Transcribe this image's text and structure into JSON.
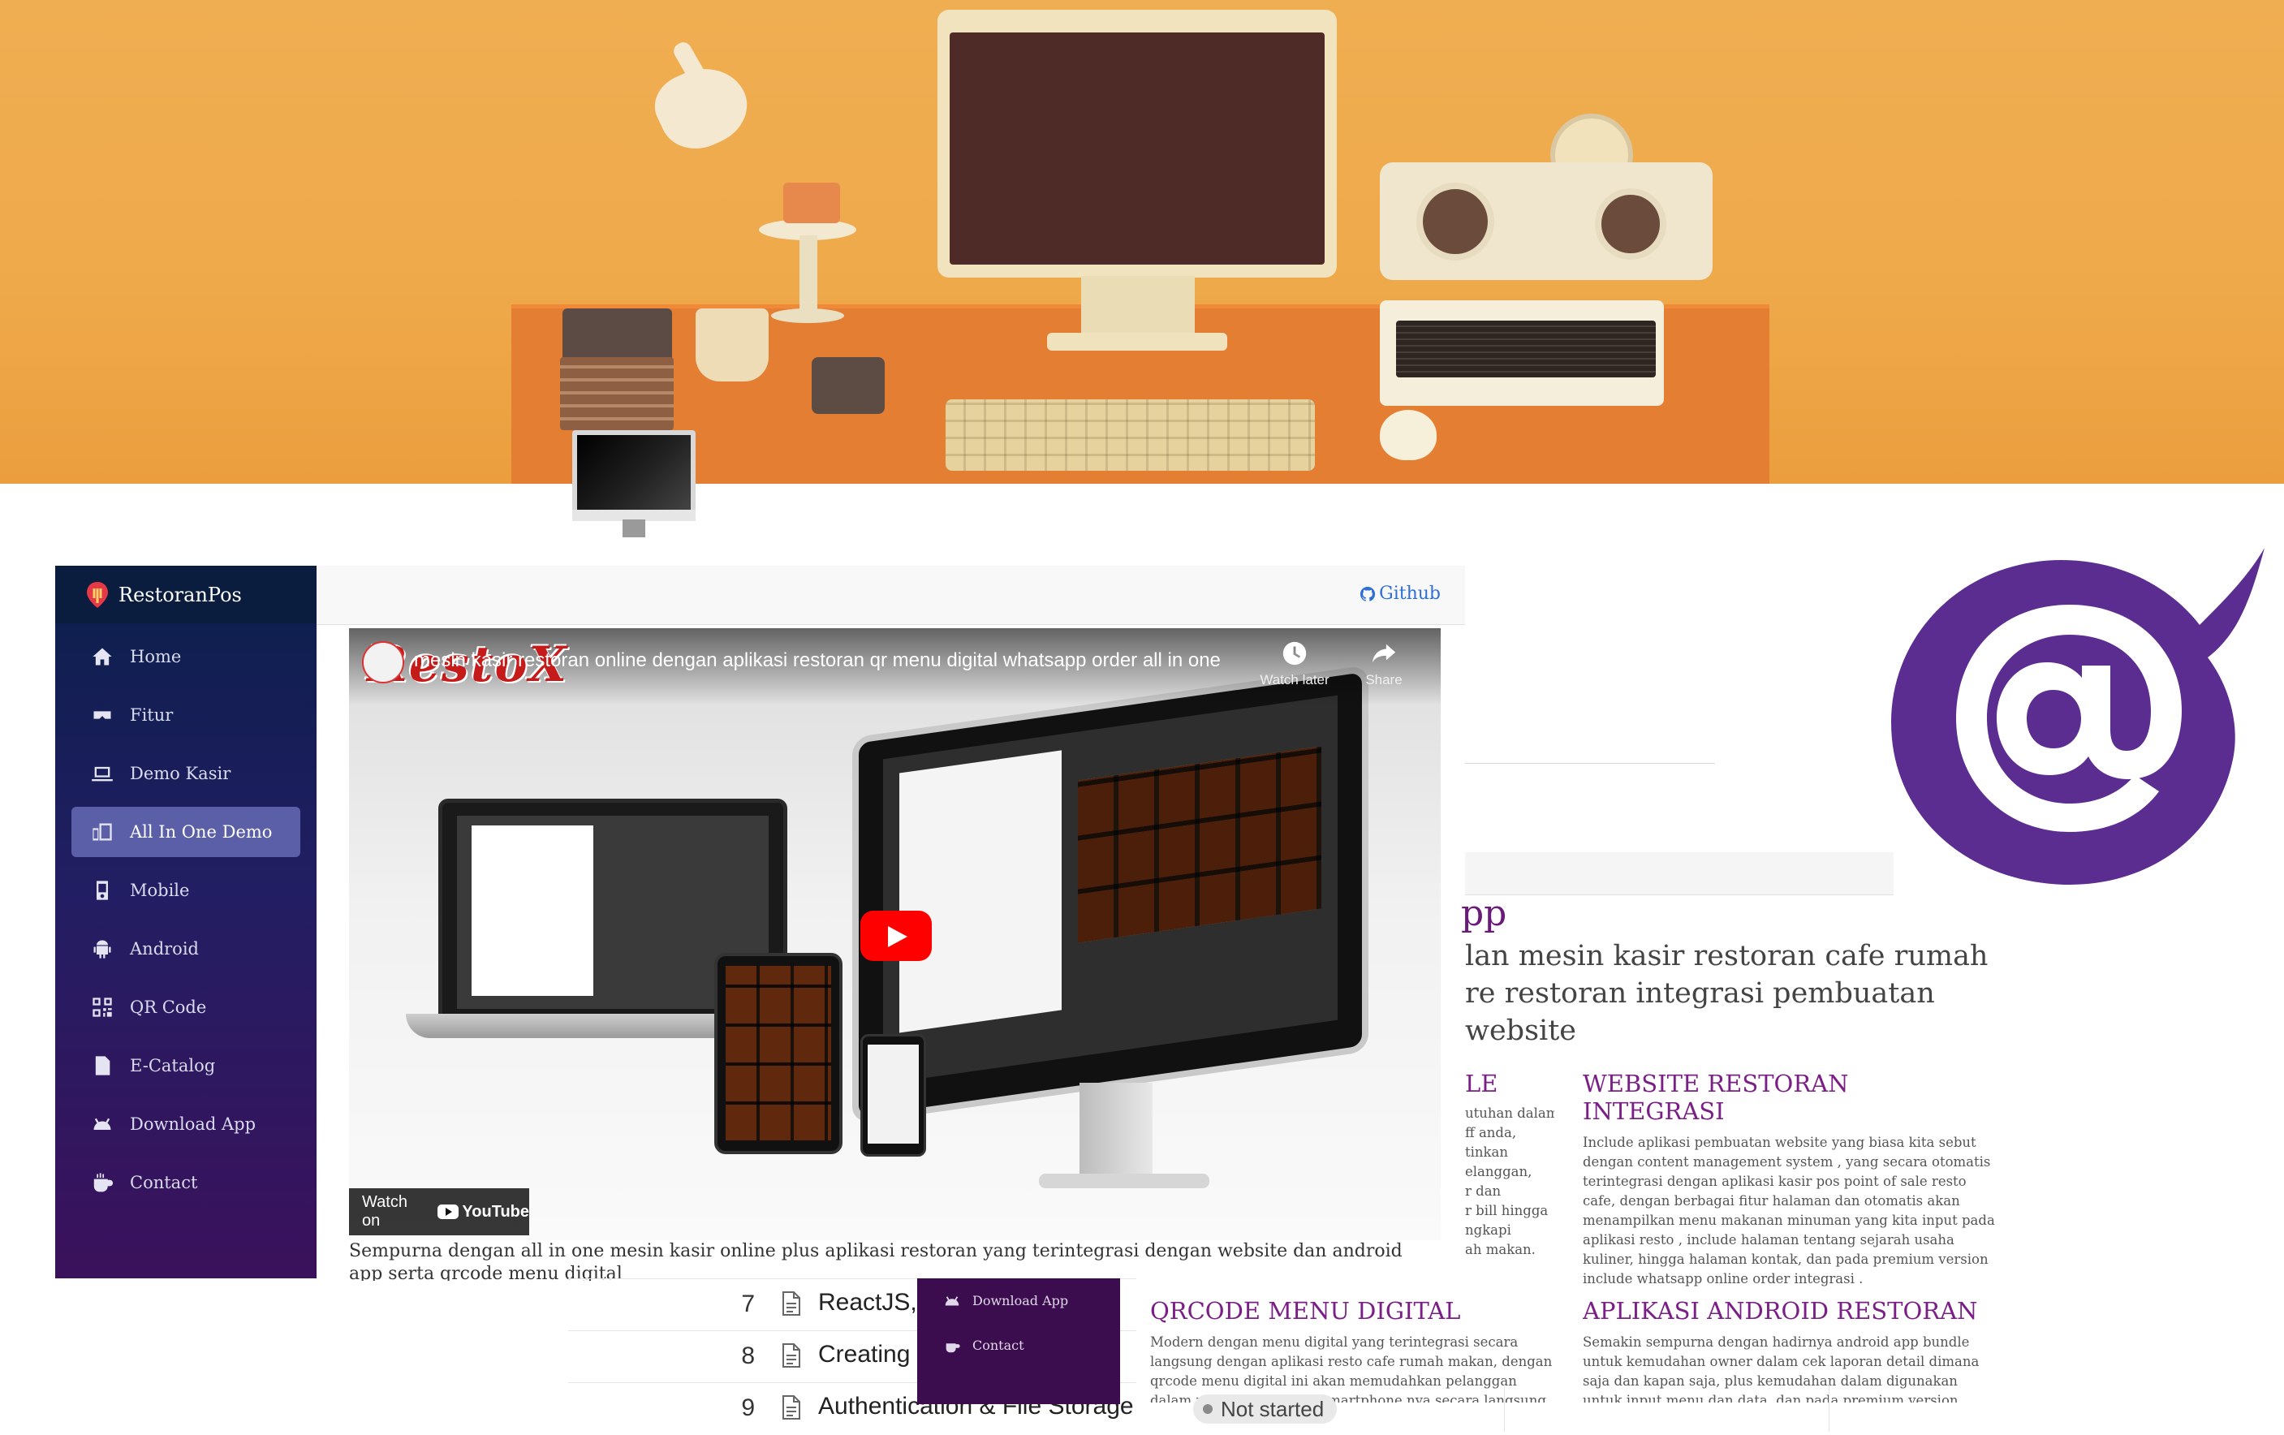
{
  "sidebar": {
    "brand": "RestoranPos",
    "items": [
      {
        "label": "Home",
        "icon": "home-icon"
      },
      {
        "label": "Fitur",
        "icon": "vr-headset-icon"
      },
      {
        "label": "Demo Kasir",
        "icon": "laptop-icon"
      },
      {
        "label": "All In One Demo",
        "icon": "devices-icon",
        "active": true
      },
      {
        "label": "Mobile",
        "icon": "mobile-icon"
      },
      {
        "label": "Android",
        "icon": "android-icon"
      },
      {
        "label": "QR Code",
        "icon": "qrcode-icon"
      },
      {
        "label": "E-Catalog",
        "icon": "pdf-file-icon"
      },
      {
        "label": "Download App",
        "icon": "android-head-icon"
      },
      {
        "label": "Contact",
        "icon": "coffee-icon"
      }
    ]
  },
  "topbar": {
    "github_label": "Github"
  },
  "video": {
    "title": "mesin kasir restoran online dengan aplikasi restoran qr menu digital whatsapp order all in one",
    "channel_logo_text": "RestoX",
    "watch_later": "Watch later",
    "share": "Share",
    "watch_on": "Watch on",
    "youtube": "YouTube"
  },
  "caption": "Sempurna dengan all in one mesin kasir online plus aplikasi restoran yang terintegrasi dengan website dan android app serta qrcode menu digital",
  "main": {
    "app_heading": "pp",
    "intro_line1": "lan mesin kasir restoran cafe rumah",
    "intro_line2": "re restoran integrasi pembuatan website"
  },
  "features": {
    "partial": {
      "title": "LE",
      "lines": [
        "utuhan dalam",
        "ff anda,",
        "tinkan",
        "elanggan,",
        "r dan",
        "r bill hingga",
        "ngkapi",
        "ah makan."
      ]
    },
    "website": {
      "title": "WEBSITE RESTORAN INTEGRASI",
      "text": "Include aplikasi pembuatan website yang biasa kita sebut dengan content management system , yang secara otomatis terintegrasi dengan aplikasi kasir pos point of sale resto cafe, dengan berbagai fitur halaman dan otomatis akan menampilkan menu makanan minuman yang kita input pada aplikasi resto , include halaman tentang sejarah usaha kuliner, hingga halaman kontak, dan pada premium version include whatsapp online order integrasi ."
    },
    "qrcode": {
      "title": "QRCODE MENU DIGITAL",
      "text": "Modern dengan menu digital yang terintegrasi secara langsung dengan aplikasi resto cafe rumah makan, dengan qrcode menu digital ini akan memudahkan pelanggan dalam memilih menu via smartphone nya secara langsung, cara penggunaan nya pun"
    },
    "android": {
      "title": "APLIKASI ANDROID RESTORAN",
      "text": "Semakin sempurna dengan hadirnya android app bundle untuk kemudahan owner dalam cek laporan detail dimana saja dan kapan saja, plus kemudahan dalam digunakan untuk input menu dan data, dan pada premium version sudah termasuk"
    }
  },
  "doc_list": [
    {
      "num": "7",
      "text": "ReactJS,"
    },
    {
      "num": "8",
      "text": "Creating"
    },
    {
      "num": "9",
      "text": "Authentication & File Storage"
    }
  ],
  "popup_menu": [
    {
      "label": "Download App",
      "icon": "android-head-icon"
    },
    {
      "label": "Contact",
      "icon": "coffee-icon"
    }
  ],
  "status": {
    "label": "Not started"
  },
  "colors": {
    "banner": "#eea94a",
    "sidebar_top": "#0a1f4a",
    "sidebar_bottom": "#3b115c",
    "accent_purple": "#7a1f86",
    "blazor_purple": "#5c2d91",
    "github_blue": "#2f6fd6"
  }
}
